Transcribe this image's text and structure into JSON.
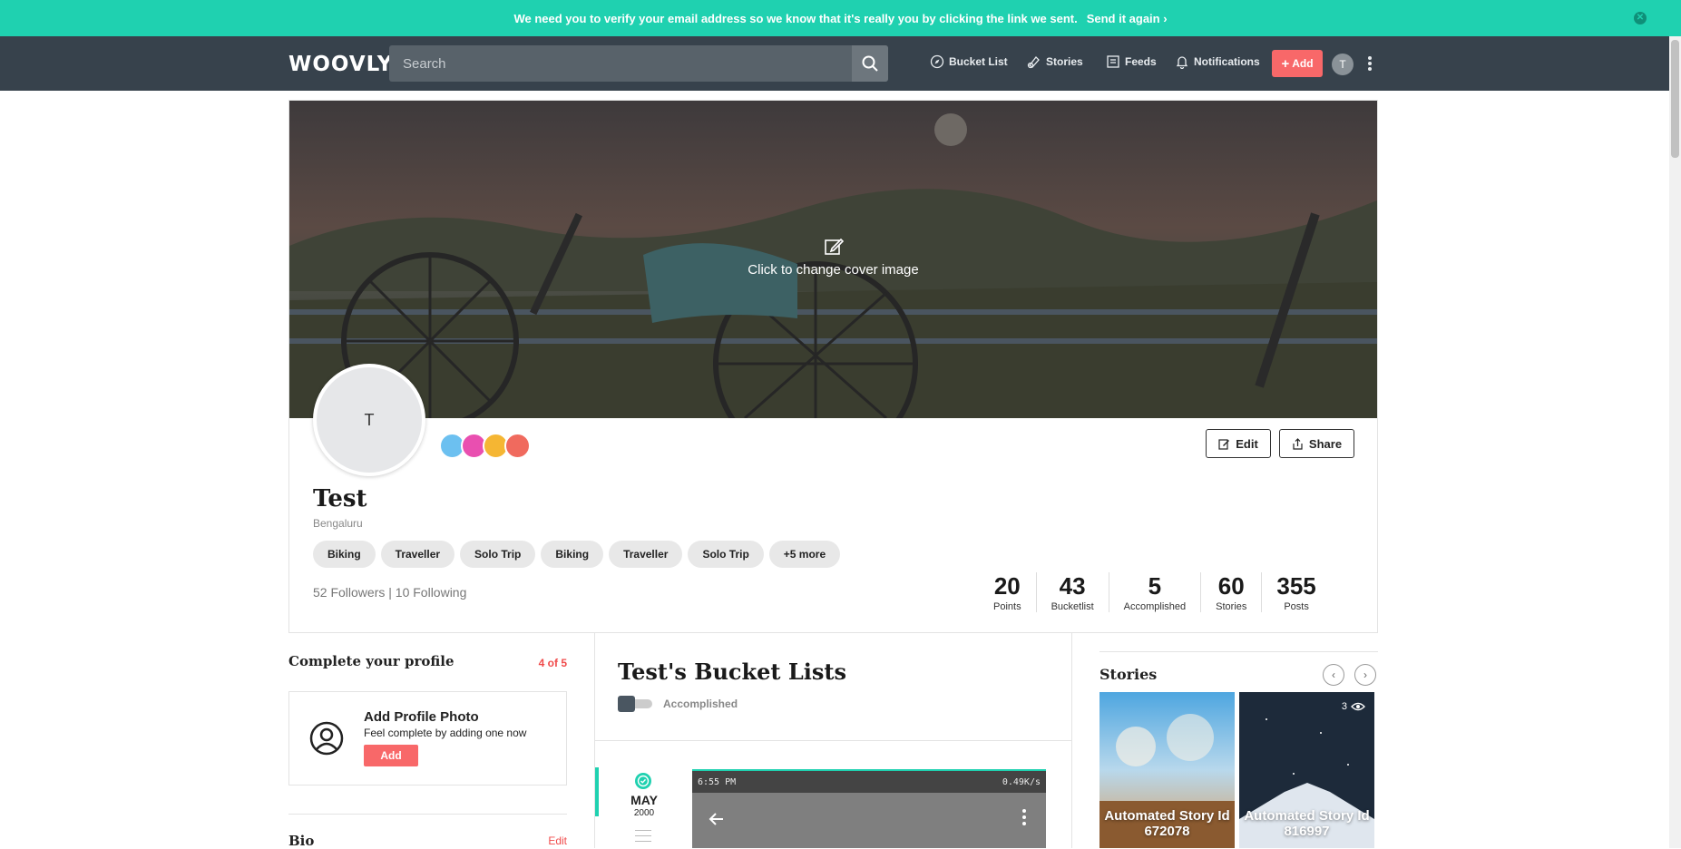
{
  "banner": {
    "message": "We need you to verify your email address so we know that it's really you by clicking the link we sent.",
    "link": "Send it again"
  },
  "nav": {
    "logo": "WOOVLY",
    "search_placeholder": "Search",
    "items": [
      {
        "label": "Bucket List",
        "icon": "compass-icon"
      },
      {
        "label": "Stories",
        "icon": "stories-icon"
      },
      {
        "label": "Feeds",
        "icon": "feeds-icon"
      },
      {
        "label": "Notifications",
        "icon": "bell-icon"
      }
    ],
    "add_label": "Add",
    "avatar_initial": "T"
  },
  "profile": {
    "cover_cta": "Click to change cover image",
    "avatar_initial": "T",
    "name": "Test",
    "city": "Bengaluru",
    "edit_label": "Edit",
    "share_label": "Share",
    "badge_colors": [
      "#6cc0f0",
      "#e94fb0",
      "#f5b633",
      "#f06a5e"
    ],
    "tags": [
      "Biking",
      "Traveller",
      "Solo Trip",
      "Biking",
      "Traveller",
      "Solo Trip",
      "+5 more"
    ],
    "followers": "52 Followers | 10 Following",
    "stats": [
      {
        "num": "20",
        "label": "Points"
      },
      {
        "num": "43",
        "label": "Bucketlist"
      },
      {
        "num": "5",
        "label": "Accomplished"
      },
      {
        "num": "60",
        "label": "Stories"
      },
      {
        "num": "355",
        "label": "Posts"
      }
    ]
  },
  "complete": {
    "title": "Complete your profile",
    "count": "4 of 5",
    "heading": "Add Profile Photo",
    "sub": "Feel complete by adding one now",
    "add": "Add"
  },
  "bio": {
    "title": "Bio",
    "edit": "Edit"
  },
  "bucket": {
    "title": "Test's Bucket Lists",
    "toggle_label": "Accomplished",
    "date_month": "MAY",
    "date_year": "2000",
    "phone_time": "6:55 PM",
    "phone_right": "0.49K/s"
  },
  "stories": {
    "title": "Stories",
    "items": [
      {
        "caption": "Automated Story Id 672078",
        "views": ""
      },
      {
        "caption": "Automated Story Id 816997",
        "views": "3"
      }
    ]
  }
}
